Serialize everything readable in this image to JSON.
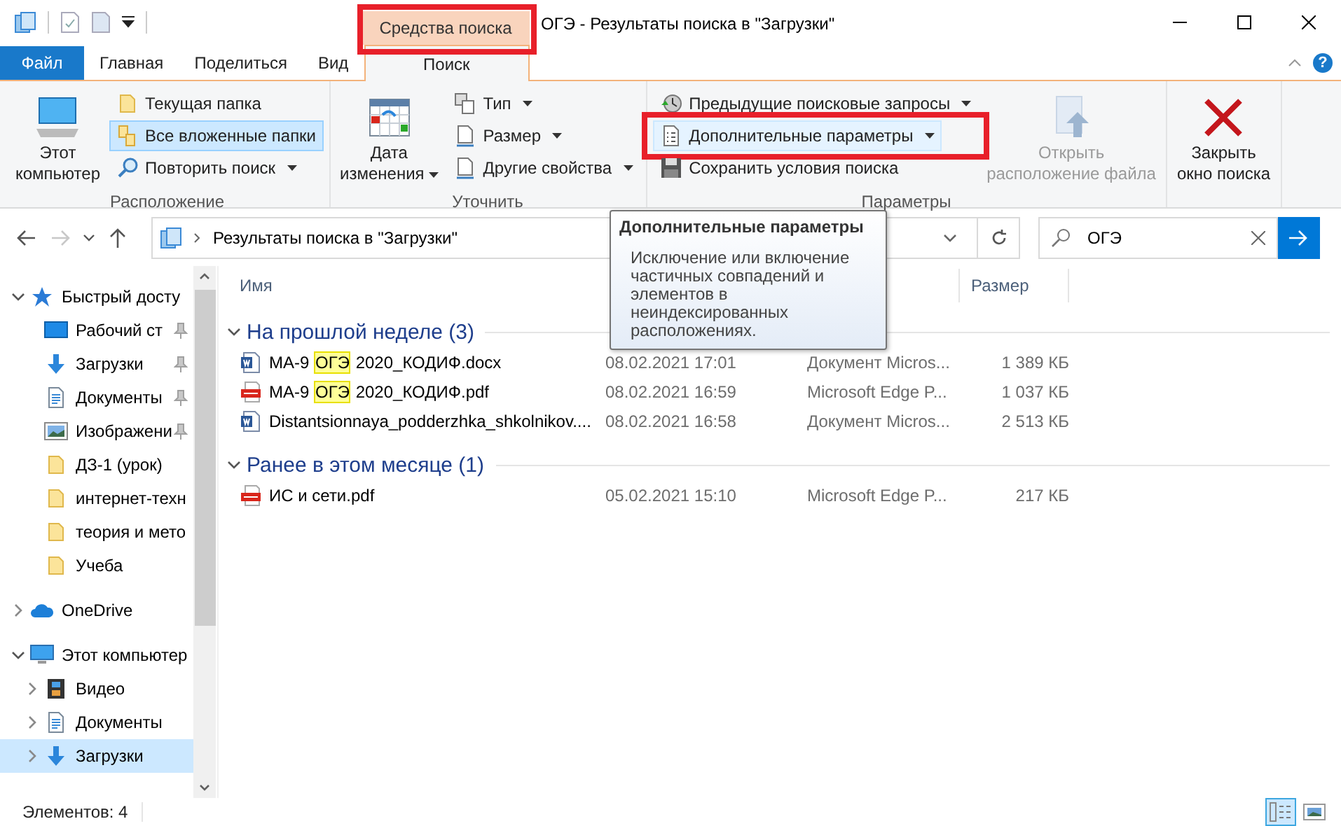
{
  "window": {
    "title": "ОГЭ - Результаты поиска в \"Загрузки\"",
    "context_tab": {
      "label": "Средства поиска",
      "annotated": true
    }
  },
  "ribbon_tabs": [
    {
      "label": "Файл",
      "kind": "file",
      "selected": false
    },
    {
      "label": "Главная",
      "kind": "tab",
      "selected": false
    },
    {
      "label": "Поделиться",
      "kind": "tab",
      "selected": false
    },
    {
      "label": "Вид",
      "kind": "tab",
      "selected": false
    },
    {
      "label": "Поиск",
      "kind": "tab",
      "selected": true
    }
  ],
  "help_button": "?",
  "ribbon_groups": [
    {
      "label": "Расположение",
      "items": [
        {
          "kind": "large",
          "lines": [
            "Этот",
            "компьютер"
          ],
          "dropdown": false,
          "selected": false,
          "disabled": false
        },
        {
          "kind": "small",
          "lines": [
            "Текущая папка"
          ],
          "dropdown": false,
          "selected": false,
          "disabled": false
        },
        {
          "kind": "small",
          "lines": [
            "Все вложенные папки"
          ],
          "dropdown": false,
          "selected": true,
          "disabled": false
        },
        {
          "kind": "small",
          "lines": [
            "Повторить поиск"
          ],
          "dropdown": true,
          "selected": false,
          "disabled": false
        }
      ]
    },
    {
      "label": "Уточнить",
      "items": [
        {
          "kind": "large",
          "lines": [
            "Дата",
            "изменения"
          ],
          "dropdown": true,
          "selected": false,
          "disabled": false
        },
        {
          "kind": "small",
          "lines": [
            "Тип"
          ],
          "dropdown": true,
          "selected": false,
          "disabled": false
        },
        {
          "kind": "small",
          "lines": [
            "Размер"
          ],
          "dropdown": true,
          "selected": false,
          "disabled": false
        },
        {
          "kind": "small",
          "lines": [
            "Другие свойства"
          ],
          "dropdown": true,
          "selected": false,
          "disabled": false
        }
      ]
    },
    {
      "label": "Параметры",
      "items": [
        {
          "kind": "small",
          "lines": [
            "Предыдущие поисковые запросы"
          ],
          "dropdown": true,
          "selected": false,
          "disabled": false
        },
        {
          "kind": "small",
          "lines": [
            "Дополнительные параметры"
          ],
          "dropdown": true,
          "selected": false,
          "disabled": false,
          "hovered": true,
          "annotated": true
        },
        {
          "kind": "small",
          "lines": [
            "Сохранить условия поиска"
          ],
          "dropdown": false,
          "selected": false,
          "disabled": false
        },
        {
          "kind": "large",
          "lines": [
            "Открыть",
            "расположение файла"
          ],
          "dropdown": false,
          "selected": false,
          "disabled": true
        }
      ]
    },
    {
      "items": [
        {
          "kind": "large",
          "lines": [
            "Закрыть",
            "окно поиска"
          ],
          "dropdown": false,
          "selected": false,
          "disabled": false
        }
      ]
    }
  ],
  "nav_buttons": [
    {
      "kind": "back",
      "disabled": false
    },
    {
      "kind": "forward",
      "disabled": true
    },
    {
      "kind": "recent",
      "disabled": false
    },
    {
      "kind": "up",
      "disabled": false
    }
  ],
  "address": {
    "path": "Результаты поиска в \"Загрузки\""
  },
  "search": {
    "value": "ОГЭ"
  },
  "nav": [
    {
      "label": "Быстрый досту",
      "kind": "star",
      "expanded": true,
      "selected": false,
      "children": [
        {
          "label": "Рабочий ст",
          "kind": "desktop",
          "pinned": true,
          "selected": false
        },
        {
          "label": "Загрузки",
          "kind": "download",
          "pinned": true,
          "selected": false
        },
        {
          "label": "Документы",
          "kind": "documents",
          "pinned": true,
          "selected": false
        },
        {
          "label": "Изображени",
          "kind": "pictures",
          "pinned": true,
          "selected": false
        },
        {
          "label": "ДЗ-1 (урок)",
          "kind": "folder",
          "pinned": false,
          "selected": false
        },
        {
          "label": "интернет-техн",
          "kind": "folder",
          "pinned": false,
          "selected": false
        },
        {
          "label": "теория и мето",
          "kind": "folder",
          "pinned": false,
          "selected": false
        },
        {
          "label": "Учеба",
          "kind": "folder",
          "pinned": false,
          "selected": false
        }
      ]
    },
    {
      "label": "OneDrive",
      "kind": "cloud",
      "expanded": false,
      "selected": false
    },
    {
      "label": "Этот компьютер",
      "kind": "computer",
      "expanded": true,
      "selected": false,
      "children": [
        {
          "label": "Видео",
          "kind": "video",
          "expanded": false,
          "selected": false
        },
        {
          "label": "Документы",
          "kind": "documents",
          "expanded": false,
          "selected": false
        },
        {
          "label": "Загрузки",
          "kind": "download",
          "expanded": false,
          "selected": true
        }
      ]
    }
  ],
  "file_list": {
    "columns": [
      {
        "label": "Имя",
        "kind": "name"
      },
      {
        "label": "Размер",
        "kind": "size"
      }
    ],
    "groups": [
      {
        "label": "На прошлой неделе (3)",
        "expanded": true,
        "rows": [
          {
            "kind": "word",
            "name": [
              {
                "text": "МА-9 ",
                "match": false
              },
              {
                "text": "ОГЭ",
                "match": true
              },
              {
                "text": " 2020_КОДИФ.docx",
                "match": false
              }
            ],
            "date": "08.02.2021 17:01",
            "type": "Документ Micros...",
            "size": "1 389 КБ"
          },
          {
            "kind": "pdf",
            "name": [
              {
                "text": "МА-9 ",
                "match": false
              },
              {
                "text": "ОГЭ",
                "match": true
              },
              {
                "text": " 2020_КОДИФ.pdf",
                "match": false
              }
            ],
            "date": "08.02.2021 16:59",
            "type": "Microsoft Edge P...",
            "size": "1 037 КБ"
          },
          {
            "kind": "word",
            "name": [
              {
                "text": "Distantsionnaya_podderzhka_shkolnikov....",
                "match": false
              }
            ],
            "date": "08.02.2021 16:58",
            "type": "Документ Micros...",
            "size": "2 513 КБ"
          }
        ]
      },
      {
        "label": "Ранее в этом месяце (1)",
        "expanded": true,
        "rows": [
          {
            "kind": "pdf",
            "name": [
              {
                "text": "ИС и сети.pdf",
                "match": false
              }
            ],
            "date": "05.02.2021 15:10",
            "type": "Microsoft Edge P...",
            "size": "217 КБ"
          }
        ]
      }
    ]
  },
  "tooltip": {
    "title": "Дополнительные параметры",
    "text": "Исключение или включение частичных совпадений и элементов в неиндексированных расположениях."
  },
  "status_bar": {
    "item_count": "Элементов: 4",
    "view_buttons": [
      {
        "kind": "details",
        "selected": true
      },
      {
        "kind": "large-icons",
        "selected": false
      }
    ]
  }
}
